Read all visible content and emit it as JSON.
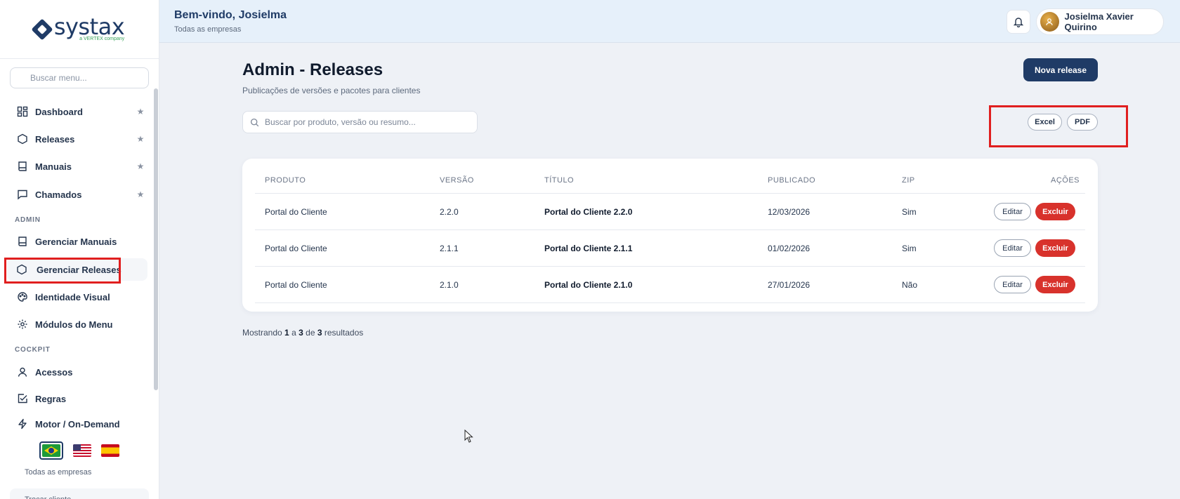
{
  "brand": {
    "name": "systax",
    "tagline": "a VERTEX company"
  },
  "sidebar": {
    "search_placeholder": "Buscar menu...",
    "items": [
      {
        "label": "Dashboard",
        "icon": "dashboard-icon",
        "starred": true
      },
      {
        "label": "Releases",
        "icon": "hexagon-icon",
        "starred": true
      },
      {
        "label": "Manuais",
        "icon": "book-icon",
        "starred": true
      },
      {
        "label": "Chamados",
        "icon": "chat-icon",
        "starred": true
      }
    ],
    "admin_section": "ADMIN",
    "admin_items": [
      {
        "label": "Gerenciar Manuais",
        "icon": "book-icon"
      },
      {
        "label": "Gerenciar Releases",
        "icon": "hexagon-icon",
        "active": true
      },
      {
        "label": "Identidade Visual",
        "icon": "palette-icon"
      },
      {
        "label": "Módulos do Menu",
        "icon": "gear-icon"
      }
    ],
    "cockpit_section": "COCKPIT",
    "cockpit_items": [
      {
        "label": "Acessos",
        "icon": "user-icon"
      },
      {
        "label": "Regras",
        "icon": "checkbox-icon"
      },
      {
        "label": "Motor / On-Demand",
        "icon": "bolt-icon"
      }
    ],
    "star_glyph": "★",
    "footer_company": "Todas as empresas",
    "switch_client": "Trocar cliente"
  },
  "header": {
    "welcome": "Bem-vindo, Josielma",
    "scope": "Todas as empresas",
    "user_name": "Josielma Xavier Quirino"
  },
  "page": {
    "title": "Admin - Releases",
    "subtitle": "Publicações de versões e pacotes para clientes",
    "new_button": "Nova release",
    "search_placeholder": "Buscar por produto, versão ou resumo...",
    "export_excel": "Excel",
    "export_pdf": "PDF"
  },
  "table": {
    "headers": {
      "produto": "PRODUTO",
      "versao": "VERSÃO",
      "titulo": "TÍTULO",
      "publicado": "PUBLICADO",
      "zip": "ZIP",
      "acoes": "AÇÕES"
    },
    "rows": [
      {
        "produto": "Portal do Cliente",
        "versao": "2.2.0",
        "titulo": "Portal do Cliente 2.2.0",
        "publicado": "12/03/2026",
        "zip": "Sim"
      },
      {
        "produto": "Portal do Cliente",
        "versao": "2.1.1",
        "titulo": "Portal do Cliente 2.1.1",
        "publicado": "01/02/2026",
        "zip": "Sim"
      },
      {
        "produto": "Portal do Cliente",
        "versao": "2.1.0",
        "titulo": "Portal do Cliente 2.1.0",
        "publicado": "27/01/2026",
        "zip": "Não"
      }
    ],
    "edit_label": "Editar",
    "delete_label": "Excluir"
  },
  "results": {
    "prefix": "Mostrando",
    "from": "1",
    "sep1": "a",
    "to": "3",
    "sep2": "de",
    "total": "3",
    "suffix": "resultados"
  },
  "colors": {
    "primary": "#1f3b66",
    "danger": "#d8322c",
    "highlight": "#e01f1f"
  }
}
